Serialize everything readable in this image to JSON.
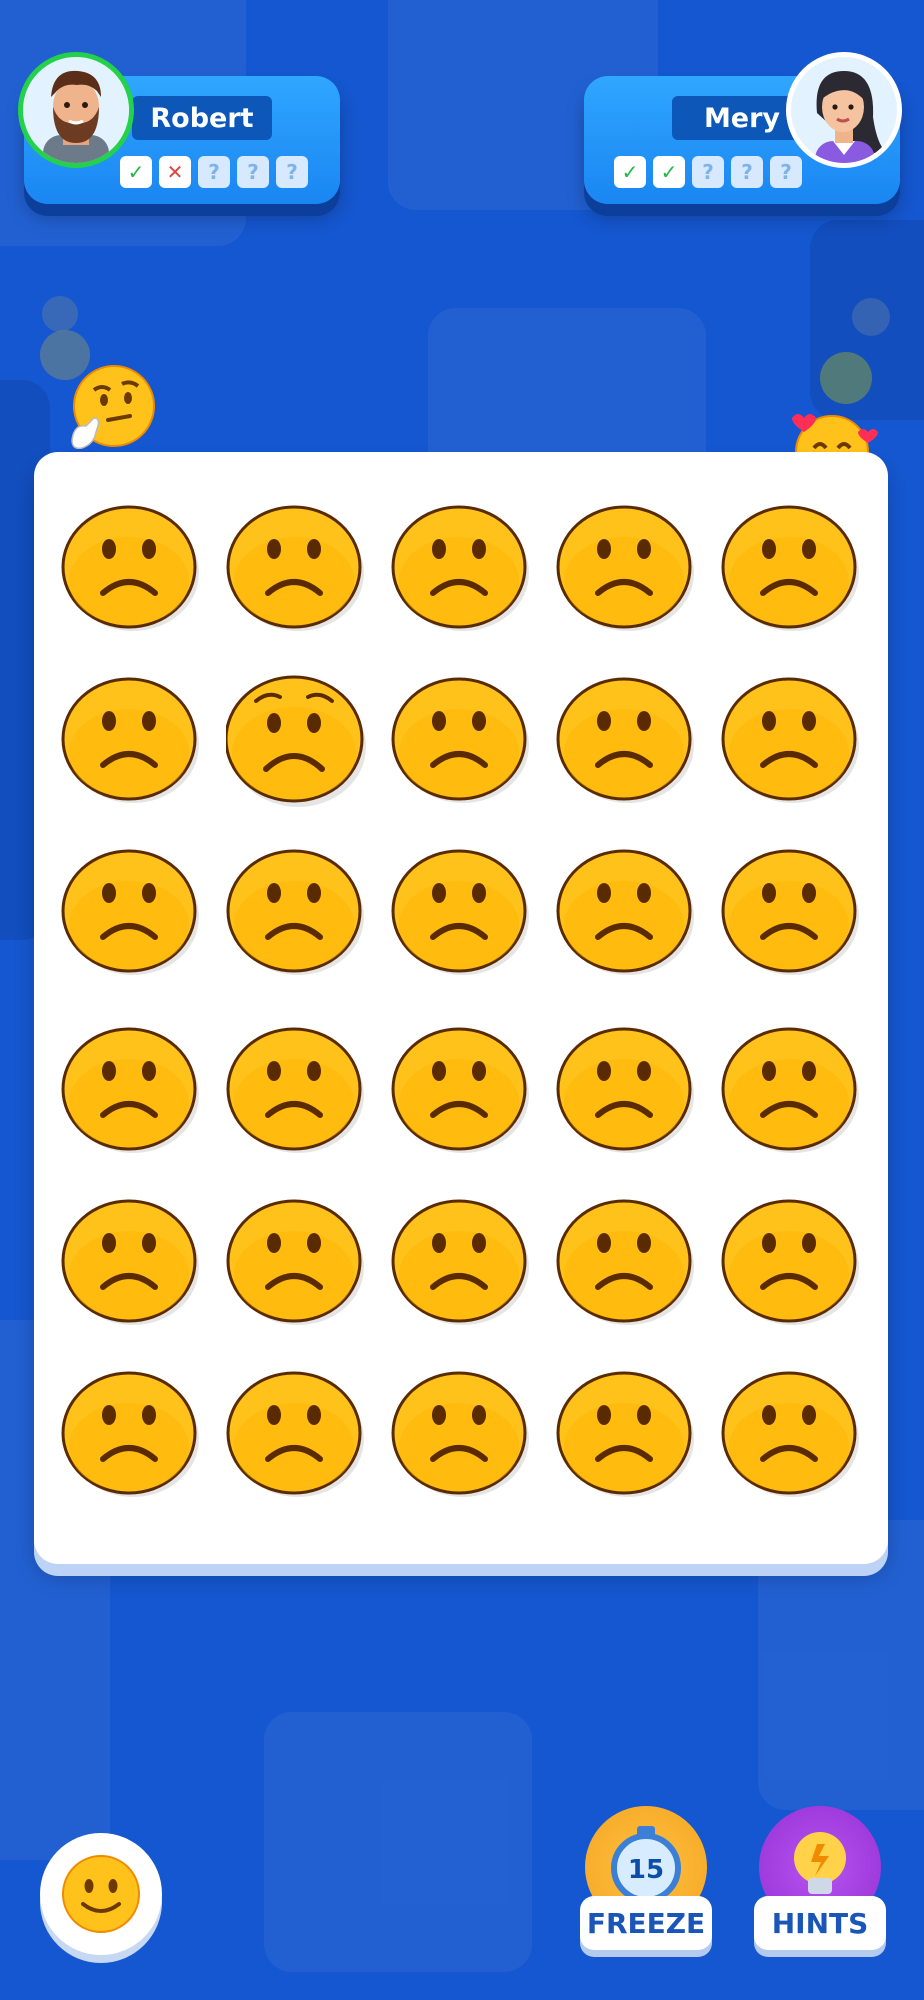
{
  "players": {
    "left": {
      "name": "Robert",
      "progress": [
        "correct",
        "wrong",
        "unknown",
        "unknown",
        "unknown"
      ]
    },
    "right": {
      "name": "Mery",
      "progress": [
        "correct",
        "correct",
        "unknown",
        "unknown",
        "unknown"
      ]
    }
  },
  "progress_symbols": {
    "correct": "✓",
    "wrong": "✕",
    "unknown": "?"
  },
  "board": {
    "rows": 6,
    "cols": 5,
    "base_emoji": "frowning-face",
    "odd_emoji": "worried-face",
    "odd_cell": {
      "row": 2,
      "col": 2
    }
  },
  "reactions": {
    "left": "thinking-face",
    "right": "smiling-face-with-hearts"
  },
  "controls": {
    "emoji_button": "slightly-smiling-face",
    "freeze": {
      "label": "FREEZE",
      "value": "15",
      "icon": "stopwatch-icon"
    },
    "hints": {
      "label": "HINTS",
      "icon": "lightbulb-icon"
    }
  },
  "colors": {
    "background": "#1557d0",
    "emoji_yellow": "#ffc21a",
    "freeze": "#f5a623",
    "hints": "#a43ee0"
  }
}
